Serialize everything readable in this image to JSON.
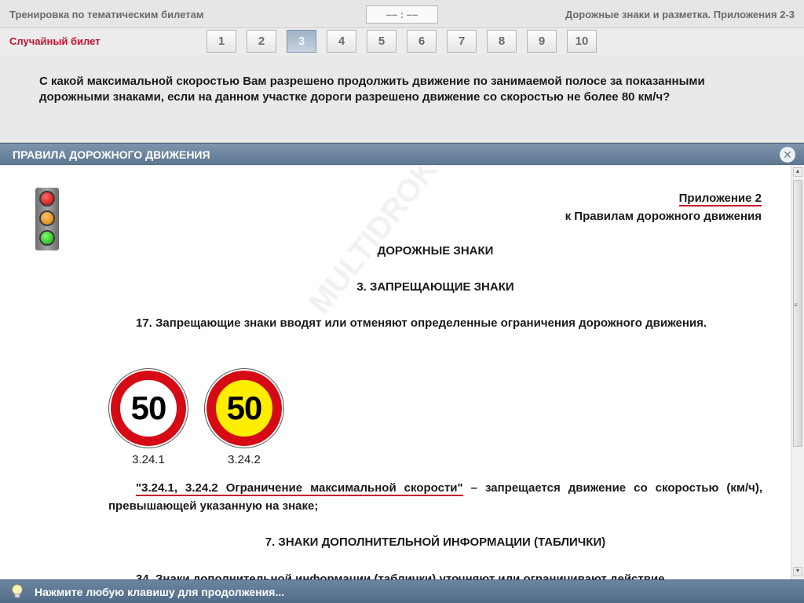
{
  "topbar": {
    "left_title": "Тренировка по тематическим билетам",
    "timer": "–– : ––",
    "right_title": "Дорожные знаки и разметка. Приложения 2-3"
  },
  "tickets": {
    "random_label": "Случайный билет",
    "items": [
      "1",
      "2",
      "3",
      "4",
      "5",
      "6",
      "7",
      "8",
      "9",
      "10"
    ],
    "active_index": 2
  },
  "question": {
    "text": "С какой максимальной скоростью Вам разрешено продолжить движение по занимаемой полосе за показанными дорожными знаками, если на данном участке дороги разрешено движение со скоростью не более 80 км/ч?"
  },
  "modal": {
    "title": "ПРАВИЛА ДОРОЖНОГО ДВИЖЕНИЯ",
    "close_glyph": "✕",
    "appendix_title": "Приложение 2",
    "appendix_subtitle": "к Правилам дорожного движения",
    "heading_main": "ДОРОЖНЫЕ ЗНАКИ",
    "heading_section": "3. ЗАПРЕЩАЮЩИЕ ЗНАКИ",
    "paragraph_17": "17. Запрещающие знаки вводят или отменяют определенные ограничения дорожного движения.",
    "signs": [
      {
        "value": "50",
        "code": "3.24.1",
        "background": "#ffffff"
      },
      {
        "value": "50",
        "code": "3.24.2",
        "background": "#ffee00"
      }
    ],
    "sign_rule_quote": "\"3.24.1, 3.24.2 Ограничение максимальной скорости\"",
    "sign_rule_text": " – запрещается движение со скоростью (км/ч), превышающей указанную на знаке;",
    "heading_section_7": "7. ЗНАКИ ДОПОЛНИТЕЛЬНОЙ ИНФОРМАЦИИ (ТАБЛИЧКИ)",
    "paragraph_34_partial": "34. Знаки дополнительной информации (таблички) уточняют или ограничивают действие",
    "watermark": "MULTIDROK.BY"
  },
  "bottombar": {
    "hint": "Нажмите любую клавишу для продолжения..."
  },
  "colors": {
    "accent_red": "#c8102e",
    "header_blue": "#5e7791",
    "sign_red": "#d60a14",
    "sign_yellow": "#ffee00"
  }
}
